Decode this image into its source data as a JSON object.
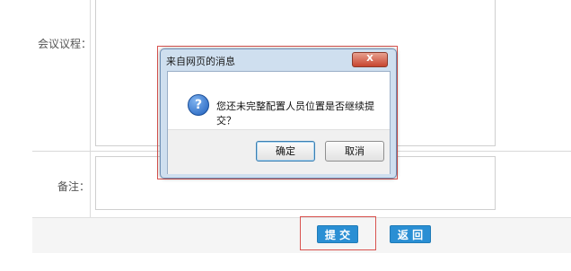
{
  "form": {
    "agenda_label": "会议议程：",
    "remark_label": "备注："
  },
  "footer": {
    "submit_label": "提 交",
    "back_label": "返 回"
  },
  "dialog": {
    "title": "来自网页的消息",
    "close_symbol": "X",
    "message": "您还未完整配置人员位置是否继续提交？",
    "ok_label": "确定",
    "cancel_label": "取消",
    "icon_symbol": "?"
  },
  "colors": {
    "accent_button": "#2a8fd4",
    "highlight_border": "#d9534f"
  }
}
